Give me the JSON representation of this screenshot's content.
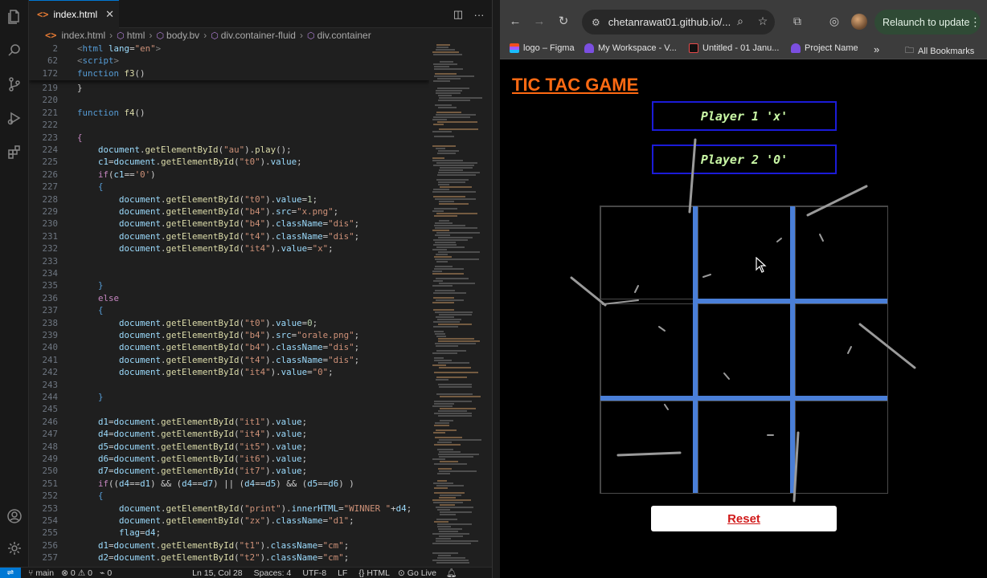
{
  "vscode": {
    "tab": {
      "filename": "index.html"
    },
    "breadcrumb": [
      "index.html",
      "html",
      "body.bv",
      "div.container-fluid",
      "div.container"
    ],
    "sticky_lines": [
      {
        "num": "2",
        "html": "<span class='t'>&lt;</span><span class='tg'>html</span> <span class='at'>lang</span>=<span class='s'>\"en\"</span><span class='t'>&gt;</span>"
      },
      {
        "num": "62",
        "html": "<span class='t'>&lt;</span><span class='tg'>script</span><span class='t'>&gt;</span>"
      },
      {
        "num": "172",
        "html": "<span class='k'>function</span> <span class='f'>f3</span>()"
      }
    ],
    "code_lines": [
      {
        "num": "219",
        "html": "}"
      },
      {
        "num": "220",
        "html": ""
      },
      {
        "num": "221",
        "html": "<span class='k'>function</span> <span class='f'>f4</span>()"
      },
      {
        "num": "222",
        "html": ""
      },
      {
        "num": "223",
        "html": "<span class='kw'>{</span>"
      },
      {
        "num": "224",
        "html": "    <span class='v'>document</span>.<span class='f'>getElementById</span>(<span class='s'>\"au\"</span>).<span class='f'>play</span>();"
      },
      {
        "num": "225",
        "html": "    <span class='v'>c1</span>=<span class='v'>document</span>.<span class='f'>getElementById</span>(<span class='s'>\"t0\"</span>).<span class='v'>value</span>;"
      },
      {
        "num": "226",
        "html": "    <span class='kw'>if</span>(<span class='v'>c1</span>==<span class='s'>'0'</span>)"
      },
      {
        "num": "227",
        "html": "    <span class='k'>{</span>"
      },
      {
        "num": "228",
        "html": "        <span class='v'>document</span>.<span class='f'>getElementById</span>(<span class='s'>\"t0\"</span>).<span class='v'>value</span>=<span class='n'>1</span>;"
      },
      {
        "num": "229",
        "html": "        <span class='v'>document</span>.<span class='f'>getElementById</span>(<span class='s'>\"b4\"</span>).<span class='v'>src</span>=<span class='s'>\"x.png\"</span>;"
      },
      {
        "num": "230",
        "html": "        <span class='v'>document</span>.<span class='f'>getElementById</span>(<span class='s'>\"b4\"</span>).<span class='v'>className</span>=<span class='s'>\"dis\"</span>;"
      },
      {
        "num": "231",
        "html": "        <span class='v'>document</span>.<span class='f'>getElementById</span>(<span class='s'>\"t4\"</span>).<span class='v'>className</span>=<span class='s'>\"dis\"</span>;"
      },
      {
        "num": "232",
        "html": "        <span class='v'>document</span>.<span class='f'>getElementById</span>(<span class='s'>\"it4\"</span>).<span class='v'>value</span>=<span class='s'>\"x\"</span>;"
      },
      {
        "num": "233",
        "html": ""
      },
      {
        "num": "234",
        "html": ""
      },
      {
        "num": "235",
        "html": "    <span class='k'>}</span>"
      },
      {
        "num": "236",
        "html": "    <span class='kw'>else</span>"
      },
      {
        "num": "237",
        "html": "    <span class='k'>{</span>"
      },
      {
        "num": "238",
        "html": "        <span class='v'>document</span>.<span class='f'>getElementById</span>(<span class='s'>\"t0\"</span>).<span class='v'>value</span>=<span class='n'>0</span>;"
      },
      {
        "num": "239",
        "html": "        <span class='v'>document</span>.<span class='f'>getElementById</span>(<span class='s'>\"b4\"</span>).<span class='v'>src</span>=<span class='s'>\"orale.png\"</span>;"
      },
      {
        "num": "240",
        "html": "        <span class='v'>document</span>.<span class='f'>getElementById</span>(<span class='s'>\"b4\"</span>).<span class='v'>className</span>=<span class='s'>\"dis\"</span>;"
      },
      {
        "num": "241",
        "html": "        <span class='v'>document</span>.<span class='f'>getElementById</span>(<span class='s'>\"t4\"</span>).<span class='v'>className</span>=<span class='s'>\"dis\"</span>;"
      },
      {
        "num": "242",
        "html": "        <span class='v'>document</span>.<span class='f'>getElementById</span>(<span class='s'>\"it4\"</span>).<span class='v'>value</span>=<span class='s'>\"0\"</span>;"
      },
      {
        "num": "243",
        "html": ""
      },
      {
        "num": "244",
        "html": "    <span class='k'>}</span>"
      },
      {
        "num": "245",
        "html": ""
      },
      {
        "num": "246",
        "html": "    <span class='v'>d1</span>=<span class='v'>document</span>.<span class='f'>getElementById</span>(<span class='s'>\"it1\"</span>).<span class='v'>value</span>;"
      },
      {
        "num": "247",
        "html": "    <span class='v'>d4</span>=<span class='v'>document</span>.<span class='f'>getElementById</span>(<span class='s'>\"it4\"</span>).<span class='v'>value</span>;"
      },
      {
        "num": "248",
        "html": "    <span class='v'>d5</span>=<span class='v'>document</span>.<span class='f'>getElementById</span>(<span class='s'>\"it5\"</span>).<span class='v'>value</span>;"
      },
      {
        "num": "249",
        "html": "    <span class='v'>d6</span>=<span class='v'>document</span>.<span class='f'>getElementById</span>(<span class='s'>\"it6\"</span>).<span class='v'>value</span>;"
      },
      {
        "num": "250",
        "html": "    <span class='v'>d7</span>=<span class='v'>document</span>.<span class='f'>getElementById</span>(<span class='s'>\"it7\"</span>).<span class='v'>value</span>;"
      },
      {
        "num": "251",
        "html": "    <span class='kw'>if</span>((<span class='v'>d4</span>==<span class='v'>d1</span>) &amp;&amp; (<span class='v'>d4</span>==<span class='v'>d7</span>) || (<span class='v'>d4</span>==<span class='v'>d5</span>) &amp;&amp; (<span class='v'>d5</span>==<span class='v'>d6</span>) )"
      },
      {
        "num": "252",
        "html": "    <span class='k'>{</span>"
      },
      {
        "num": "253",
        "html": "        <span class='v'>document</span>.<span class='f'>getElementById</span>(<span class='s'>\"print\"</span>).<span class='v'>innerHTML</span>=<span class='s'>\"WINNER \"</span>+<span class='v'>d4</span>;"
      },
      {
        "num": "254",
        "html": "        <span class='v'>document</span>.<span class='f'>getElementById</span>(<span class='s'>\"zx\"</span>).<span class='v'>className</span>=<span class='s'>\"d1\"</span>;"
      },
      {
        "num": "255",
        "html": "        <span class='v'>flag</span>=<span class='v'>d4</span>;"
      },
      {
        "num": "256",
        "html": "    <span class='v'>d1</span>=<span class='v'>document</span>.<span class='f'>getElementById</span>(<span class='s'>\"t1\"</span>).<span class='v'>className</span>=<span class='s'>\"cm\"</span>;"
      },
      {
        "num": "257",
        "html": "    <span class='v'>d2</span>=<span class='v'>document</span>.<span class='f'>getElementById</span>(<span class='s'>\"t2\"</span>).<span class='v'>className</span>=<span class='s'>\"cm\"</span>;"
      }
    ],
    "status": {
      "branch": "main",
      "errors": "0",
      "warnings": "0",
      "ports": "0",
      "position": "Ln 15, Col 28",
      "spaces": "Spaces: 4",
      "encoding": "UTF-8",
      "eol": "LF",
      "language": "HTML",
      "golive": "Go Live"
    }
  },
  "browser": {
    "url": "chetanrawat01.github.io/...",
    "relaunch_label": "Relaunch to update",
    "bookmarks": [
      "logo – Figma",
      "My Workspace - V...",
      "Untitled - 01 Janu...",
      "Project Name",
      "All Bookmarks"
    ],
    "more_bookmarks": "»"
  },
  "game": {
    "title": "TIC TAC GAME",
    "player1": "Player 1 'x'",
    "player2": "Player 2 '0'",
    "reset_label": "Reset",
    "grid_color": "#4a7fd8",
    "title_color": "#ff6a13"
  }
}
